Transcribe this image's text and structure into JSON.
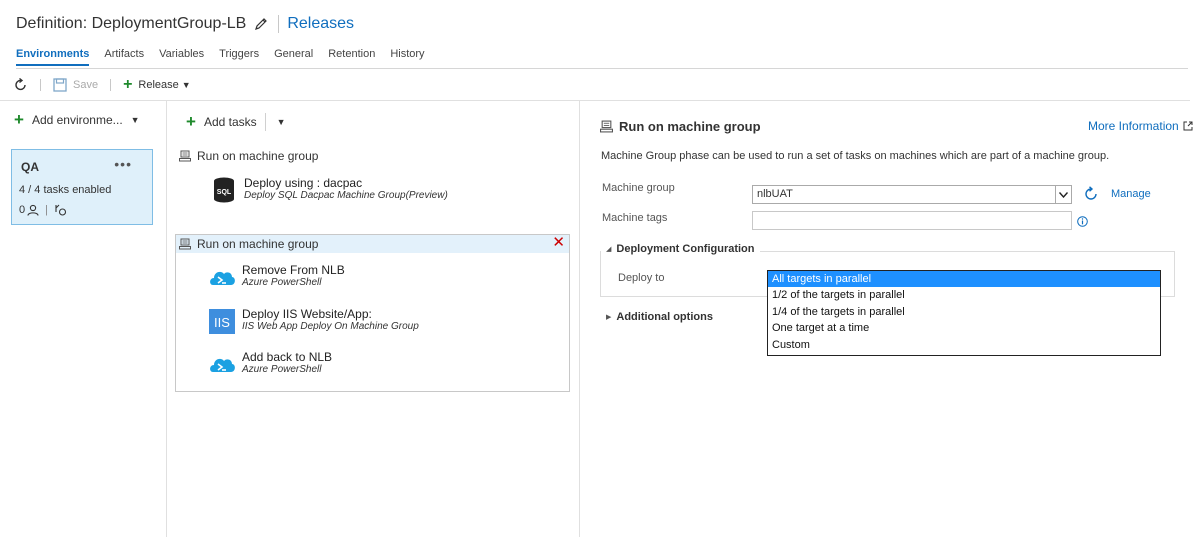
{
  "header": {
    "title": "Definition: DeploymentGroup-LB",
    "releases_link": "Releases"
  },
  "tabs": [
    {
      "label": "Environments",
      "active": true
    },
    {
      "label": "Artifacts"
    },
    {
      "label": "Variables"
    },
    {
      "label": "Triggers"
    },
    {
      "label": "General"
    },
    {
      "label": "Retention"
    },
    {
      "label": "History"
    }
  ],
  "toolbar": {
    "save_label": "Save",
    "release_label": "Release"
  },
  "environments": {
    "add_label": "Add environme...",
    "card": {
      "name": "QA",
      "more": "•••",
      "tasks_enabled": "4 / 4 tasks enabled",
      "approvers_count": "0"
    }
  },
  "tasks_panel": {
    "add_tasks_label": "Add tasks",
    "phases": [
      {
        "title": "Run on machine group",
        "tasks": [
          {
            "name": "Deploy using : dacpac",
            "desc": "Deploy SQL Dacpac Machine Group(Preview)",
            "icon": "sql-icon"
          }
        ]
      },
      {
        "title": "Run on machine group",
        "selected": true,
        "tasks": [
          {
            "name": "Remove From NLB",
            "desc": "Azure PowerShell",
            "icon": "azure-powershell-icon"
          },
          {
            "name": "Deploy IIS Website/App:",
            "desc": "IIS Web App Deploy On Machine Group",
            "icon": "iis-icon"
          },
          {
            "name": "Add back to NLB",
            "desc": "Azure PowerShell",
            "icon": "azure-powershell-icon"
          }
        ]
      }
    ]
  },
  "details": {
    "title": "Run on machine group",
    "more_info": "More Information",
    "description": "Machine Group phase can be used to run a set of tasks on machines which are part of a machine group.",
    "machine_group_label": "Machine group",
    "machine_group_value": "nlbUAT",
    "manage_label": "Manage",
    "machine_tags_label": "Machine tags",
    "deployment_config_label": "Deployment Configuration",
    "deploy_to_label": "Deploy to",
    "deploy_options": [
      "All targets in parallel",
      "1/2 of the targets in parallel",
      "1/4 of the targets in parallel",
      "One target at a time",
      "Custom"
    ],
    "selected_option": "All targets in parallel",
    "additional_options_label": "Additional options"
  },
  "colors": {
    "accent": "#106ebe",
    "add_green": "#1f8a2c",
    "selected_card": "#dff0fa",
    "dropdown_highlight": "#1e90ff",
    "close_red": "#cc0000"
  }
}
